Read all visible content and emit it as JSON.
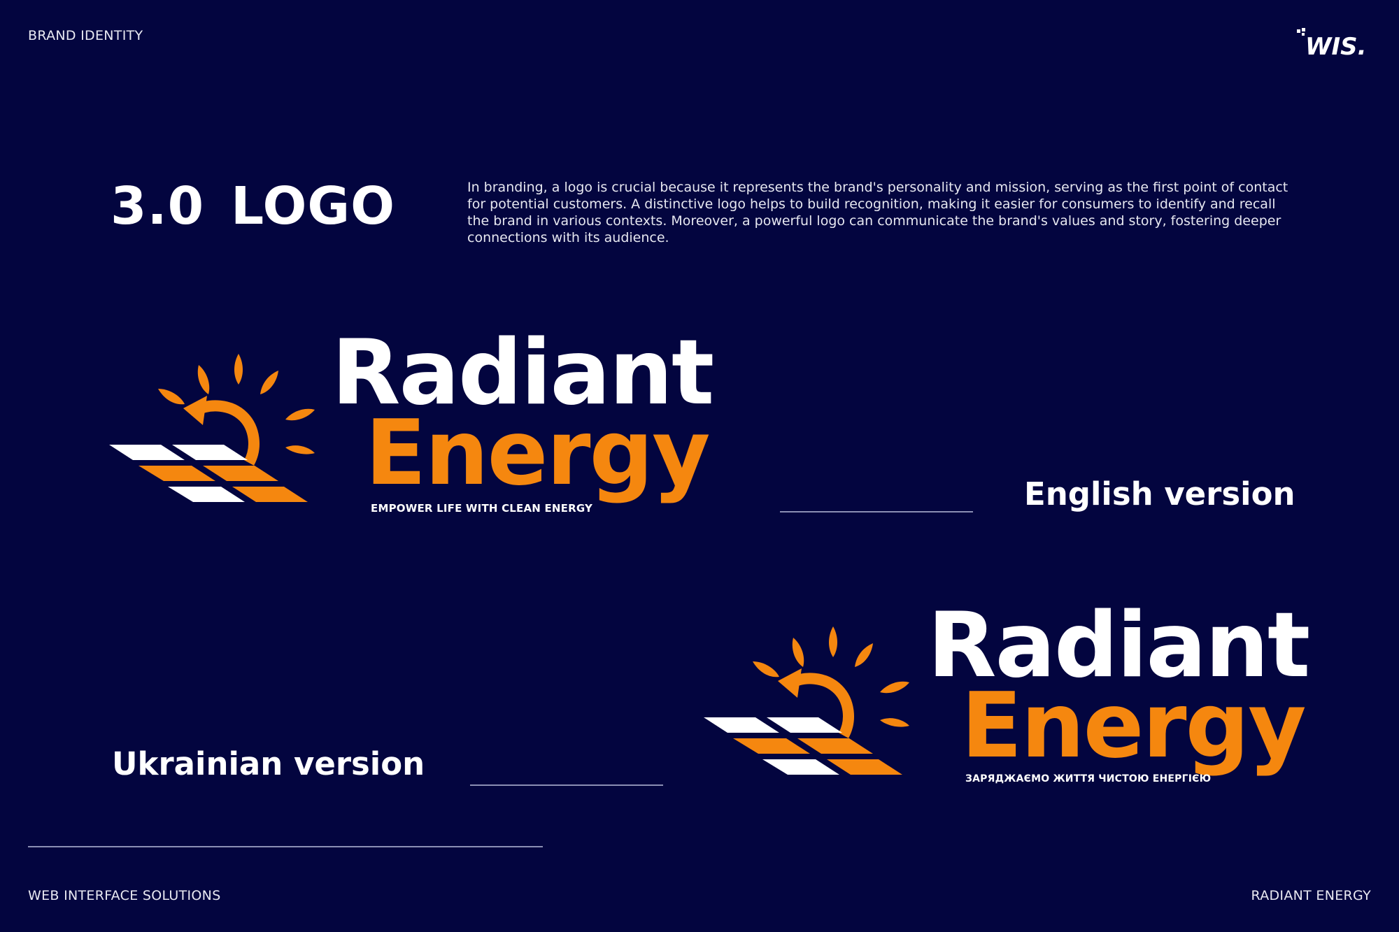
{
  "header": {
    "label": "BRAND IDENTITY",
    "brand_mark": "WIS."
  },
  "section": {
    "number": "3.0",
    "title": "LOGO",
    "description": "In branding, a logo is crucial because it represents the brand's personality and mission, serving as the first point of contact for potential customers. A distinctive logo helps to build recognition, making it easier for consumers to identify and recall the brand in various contexts. Moreover, a powerful logo can communicate the brand's values and story, fostering deeper connections with its audience."
  },
  "logos": {
    "english": {
      "line1": "Radiant",
      "line2": "Energy",
      "tagline": "EMPOWER LIFE WITH CLEAN ENERGY",
      "label": "English version"
    },
    "ukrainian": {
      "line1": "Radiant",
      "line2": "Energy",
      "tagline": "ЗАРЯДЖАЄМО ЖИТТЯ ЧИСТОЮ ЕНЕРГІЄЮ",
      "label": "Ukrainian version"
    }
  },
  "footer": {
    "left": "WEB INTERFACE SOLUTIONS",
    "right": "RADIANT ENERGY"
  },
  "colors": {
    "background": "#03053f",
    "accent_orange": "#f5870f",
    "text": "#ffffff"
  }
}
